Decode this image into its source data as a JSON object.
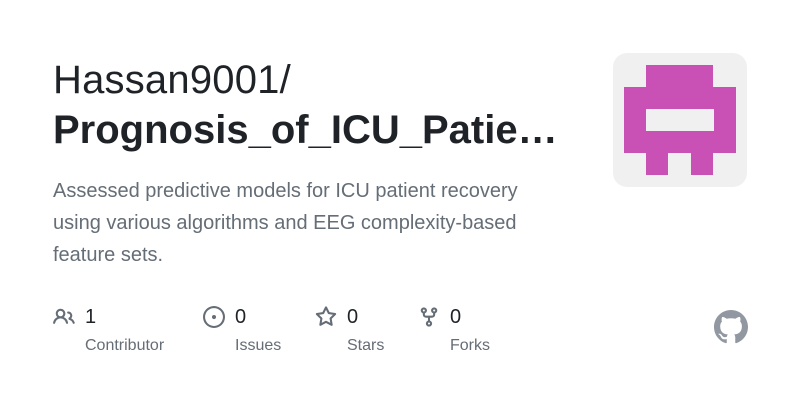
{
  "repo": {
    "owner": "Hassan9001/",
    "name": "Prognosis_of_ICU_Patient_Recovery",
    "description": "Assessed predictive models for ICU patient recovery using various algorithms and EEG complexity-based feature sets."
  },
  "stats": [
    {
      "count": "1",
      "label": "Contributor",
      "icon": "people-icon"
    },
    {
      "count": "0",
      "label": "Issues",
      "icon": "issue-opened-icon"
    },
    {
      "count": "0",
      "label": "Stars",
      "icon": "star-icon"
    },
    {
      "count": "0",
      "label": "Forks",
      "icon": "repo-forked-icon"
    }
  ],
  "colors": {
    "avatar_fill": "#c950b4",
    "avatar_bg": "#f0f0f0",
    "muted_text": "#656d76",
    "primary_text": "#1f2328",
    "github_mark": "#9198a1"
  }
}
